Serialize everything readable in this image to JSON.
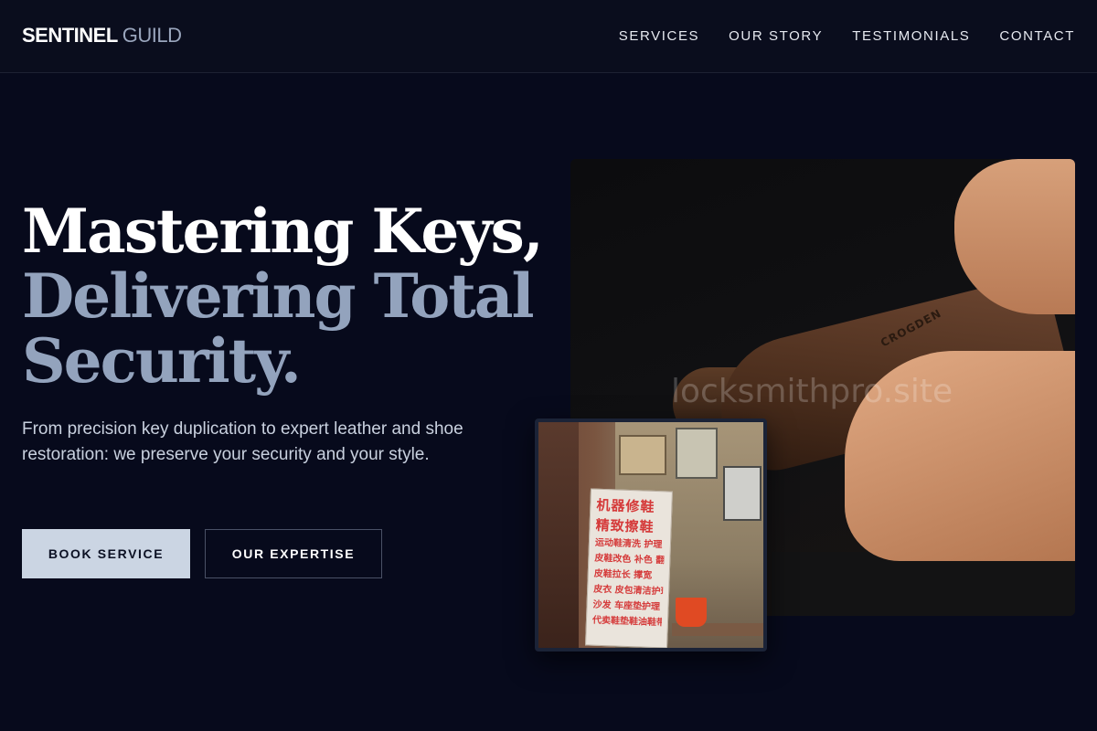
{
  "brand": {
    "name_strong": "SENTINEL",
    "name_light": "GUILD"
  },
  "nav": {
    "items": [
      {
        "label": "SERVICES"
      },
      {
        "label": "OUR STORY"
      },
      {
        "label": "TESTIMONIALS"
      },
      {
        "label": "CONTACT"
      }
    ]
  },
  "hero": {
    "headline_line1": "Mastering Keys,",
    "headline_line2": "Delivering Total",
    "headline_line3": "Security.",
    "description": "From precision key duplication to expert leather and shoe restoration: we preserve your security and your style.",
    "primary_button": "BOOK SERVICE",
    "secondary_button": "OUR EXPERTISE"
  },
  "images": {
    "main_watermark": "locksmithpro.site",
    "shoe_brand_text": "CROGDEN",
    "inset_sign_lines": [
      "机器修鞋",
      "精致擦鞋",
      "运动鞋清洗 护理",
      "皮鞋改色 补色 翻新",
      "皮鞋拉长 撑宽",
      "皮衣 皮包清洁护理",
      "沙发 车座垫护理",
      "代卖鞋垫鞋油鞋带"
    ]
  },
  "colors": {
    "background": "#070a1c",
    "accent_text": "#93a3bd",
    "primary_button_bg": "#cbd5e3"
  }
}
